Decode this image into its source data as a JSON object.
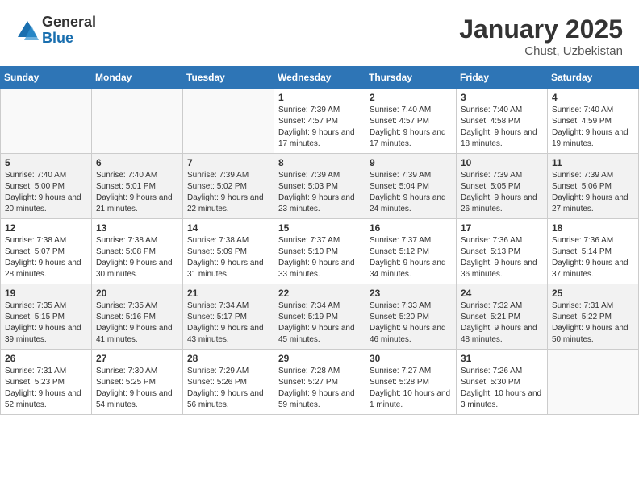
{
  "logo": {
    "general": "General",
    "blue": "Blue"
  },
  "header": {
    "month": "January 2025",
    "location": "Chust, Uzbekistan"
  },
  "weekdays": [
    "Sunday",
    "Monday",
    "Tuesday",
    "Wednesday",
    "Thursday",
    "Friday",
    "Saturday"
  ],
  "weeks": [
    [
      {
        "day": null
      },
      {
        "day": null
      },
      {
        "day": null
      },
      {
        "day": "1",
        "sunrise": "7:39 AM",
        "sunset": "4:57 PM",
        "daylight": "9 hours and 17 minutes."
      },
      {
        "day": "2",
        "sunrise": "7:40 AM",
        "sunset": "4:57 PM",
        "daylight": "9 hours and 17 minutes."
      },
      {
        "day": "3",
        "sunrise": "7:40 AM",
        "sunset": "4:58 PM",
        "daylight": "9 hours and 18 minutes."
      },
      {
        "day": "4",
        "sunrise": "7:40 AM",
        "sunset": "4:59 PM",
        "daylight": "9 hours and 19 minutes."
      }
    ],
    [
      {
        "day": "5",
        "sunrise": "7:40 AM",
        "sunset": "5:00 PM",
        "daylight": "9 hours and 20 minutes."
      },
      {
        "day": "6",
        "sunrise": "7:40 AM",
        "sunset": "5:01 PM",
        "daylight": "9 hours and 21 minutes."
      },
      {
        "day": "7",
        "sunrise": "7:39 AM",
        "sunset": "5:02 PM",
        "daylight": "9 hours and 22 minutes."
      },
      {
        "day": "8",
        "sunrise": "7:39 AM",
        "sunset": "5:03 PM",
        "daylight": "9 hours and 23 minutes."
      },
      {
        "day": "9",
        "sunrise": "7:39 AM",
        "sunset": "5:04 PM",
        "daylight": "9 hours and 24 minutes."
      },
      {
        "day": "10",
        "sunrise": "7:39 AM",
        "sunset": "5:05 PM",
        "daylight": "9 hours and 26 minutes."
      },
      {
        "day": "11",
        "sunrise": "7:39 AM",
        "sunset": "5:06 PM",
        "daylight": "9 hours and 27 minutes."
      }
    ],
    [
      {
        "day": "12",
        "sunrise": "7:38 AM",
        "sunset": "5:07 PM",
        "daylight": "9 hours and 28 minutes."
      },
      {
        "day": "13",
        "sunrise": "7:38 AM",
        "sunset": "5:08 PM",
        "daylight": "9 hours and 30 minutes."
      },
      {
        "day": "14",
        "sunrise": "7:38 AM",
        "sunset": "5:09 PM",
        "daylight": "9 hours and 31 minutes."
      },
      {
        "day": "15",
        "sunrise": "7:37 AM",
        "sunset": "5:10 PM",
        "daylight": "9 hours and 33 minutes."
      },
      {
        "day": "16",
        "sunrise": "7:37 AM",
        "sunset": "5:12 PM",
        "daylight": "9 hours and 34 minutes."
      },
      {
        "day": "17",
        "sunrise": "7:36 AM",
        "sunset": "5:13 PM",
        "daylight": "9 hours and 36 minutes."
      },
      {
        "day": "18",
        "sunrise": "7:36 AM",
        "sunset": "5:14 PM",
        "daylight": "9 hours and 37 minutes."
      }
    ],
    [
      {
        "day": "19",
        "sunrise": "7:35 AM",
        "sunset": "5:15 PM",
        "daylight": "9 hours and 39 minutes."
      },
      {
        "day": "20",
        "sunrise": "7:35 AM",
        "sunset": "5:16 PM",
        "daylight": "9 hours and 41 minutes."
      },
      {
        "day": "21",
        "sunrise": "7:34 AM",
        "sunset": "5:17 PM",
        "daylight": "9 hours and 43 minutes."
      },
      {
        "day": "22",
        "sunrise": "7:34 AM",
        "sunset": "5:19 PM",
        "daylight": "9 hours and 45 minutes."
      },
      {
        "day": "23",
        "sunrise": "7:33 AM",
        "sunset": "5:20 PM",
        "daylight": "9 hours and 46 minutes."
      },
      {
        "day": "24",
        "sunrise": "7:32 AM",
        "sunset": "5:21 PM",
        "daylight": "9 hours and 48 minutes."
      },
      {
        "day": "25",
        "sunrise": "7:31 AM",
        "sunset": "5:22 PM",
        "daylight": "9 hours and 50 minutes."
      }
    ],
    [
      {
        "day": "26",
        "sunrise": "7:31 AM",
        "sunset": "5:23 PM",
        "daylight": "9 hours and 52 minutes."
      },
      {
        "day": "27",
        "sunrise": "7:30 AM",
        "sunset": "5:25 PM",
        "daylight": "9 hours and 54 minutes."
      },
      {
        "day": "28",
        "sunrise": "7:29 AM",
        "sunset": "5:26 PM",
        "daylight": "9 hours and 56 minutes."
      },
      {
        "day": "29",
        "sunrise": "7:28 AM",
        "sunset": "5:27 PM",
        "daylight": "9 hours and 59 minutes."
      },
      {
        "day": "30",
        "sunrise": "7:27 AM",
        "sunset": "5:28 PM",
        "daylight": "10 hours and 1 minute."
      },
      {
        "day": "31",
        "sunrise": "7:26 AM",
        "sunset": "5:30 PM",
        "daylight": "10 hours and 3 minutes."
      },
      {
        "day": null
      }
    ]
  ]
}
